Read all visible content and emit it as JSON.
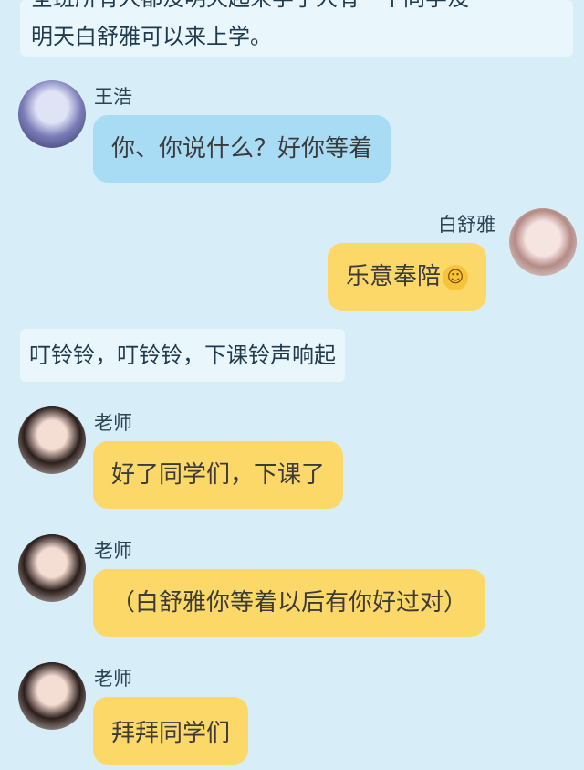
{
  "narration": {
    "top_line1": "全班所有人都没明天起来学了大有一个同学没",
    "top_line2": "明天白舒雅可以来上学。",
    "middle": "叮铃铃，叮铃铃，下课铃声响起"
  },
  "messages": [
    {
      "sender": "王浩",
      "text": "你、你说什么？好你等着",
      "icon": "avatar-boy-icon"
    },
    {
      "sender": "白舒雅",
      "text": "乐意奉陪",
      "emoji": "wink-smile-emoji",
      "icon": "avatar-girl-icon"
    },
    {
      "sender": "老师",
      "text": "好了同学们，下课了",
      "icon": "avatar-teacher-icon"
    },
    {
      "sender": "老师",
      "text": "（白舒雅你等着以后有你好过对）",
      "icon": "avatar-teacher-icon"
    },
    {
      "sender": "老师",
      "text": "拜拜同学们",
      "icon": "avatar-teacher-icon"
    }
  ],
  "colors": {
    "background": "#d7edf7",
    "narration_bg": "#e9f6fc",
    "bubble_blue": "#a8dcf5",
    "bubble_yellow": "#fcd868"
  }
}
